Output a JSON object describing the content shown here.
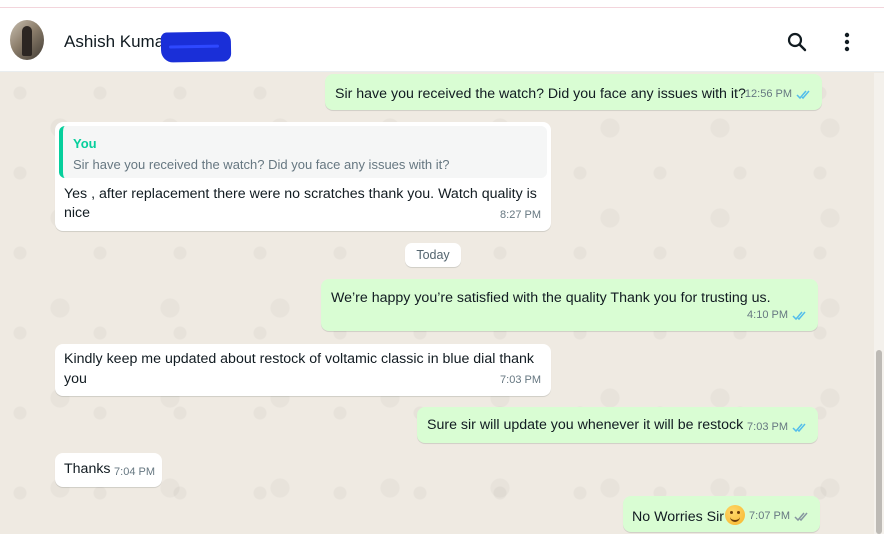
{
  "header": {
    "contact_name": "Ashish Kumar",
    "search_icon": "search-icon",
    "menu_icon": "more-vertical-icon"
  },
  "colors": {
    "outgoing_bubble": "#d9fdd3",
    "incoming_bubble": "#ffffff",
    "chat_background": "#efeae2",
    "read_tick": "#53bdeb",
    "quote_accent": "#06cf9c",
    "redaction": "#1a2fd8"
  },
  "messages": [
    {
      "direction": "outgoing",
      "text": "Sir have you received the watch? Did you face any issues with it?",
      "time": "12:56 PM",
      "status": "read"
    },
    {
      "direction": "incoming",
      "quote_author": "You",
      "quote_text": "Sir have you received the watch? Did you face any issues with it?",
      "text_line1": "Yes , after replacement there were no scratches thank you. Watch quality is",
      "text_line2": "nice",
      "time": "8:27 PM"
    },
    {
      "direction": "outgoing",
      "text": "We’re happy you’re satisfied with the quality Thank you for trusting us.",
      "time": "4:10 PM",
      "status": "read"
    },
    {
      "direction": "incoming",
      "text_line1": "Kindly keep me updated about restock of voltamic classic in blue dial thank",
      "text_line2": "you",
      "time": "7:03 PM"
    },
    {
      "direction": "outgoing",
      "text": "Sure sir will update you whenever it will be restock",
      "time": "7:03 PM",
      "status": "read"
    },
    {
      "direction": "incoming",
      "text": "Thanks",
      "time": "7:04 PM"
    },
    {
      "direction": "outgoing",
      "text": "No Worries Sir",
      "emoji": "smiling-face-emoji",
      "time": "7:07 PM",
      "status": "delivered"
    }
  ],
  "date_separator": "Today"
}
